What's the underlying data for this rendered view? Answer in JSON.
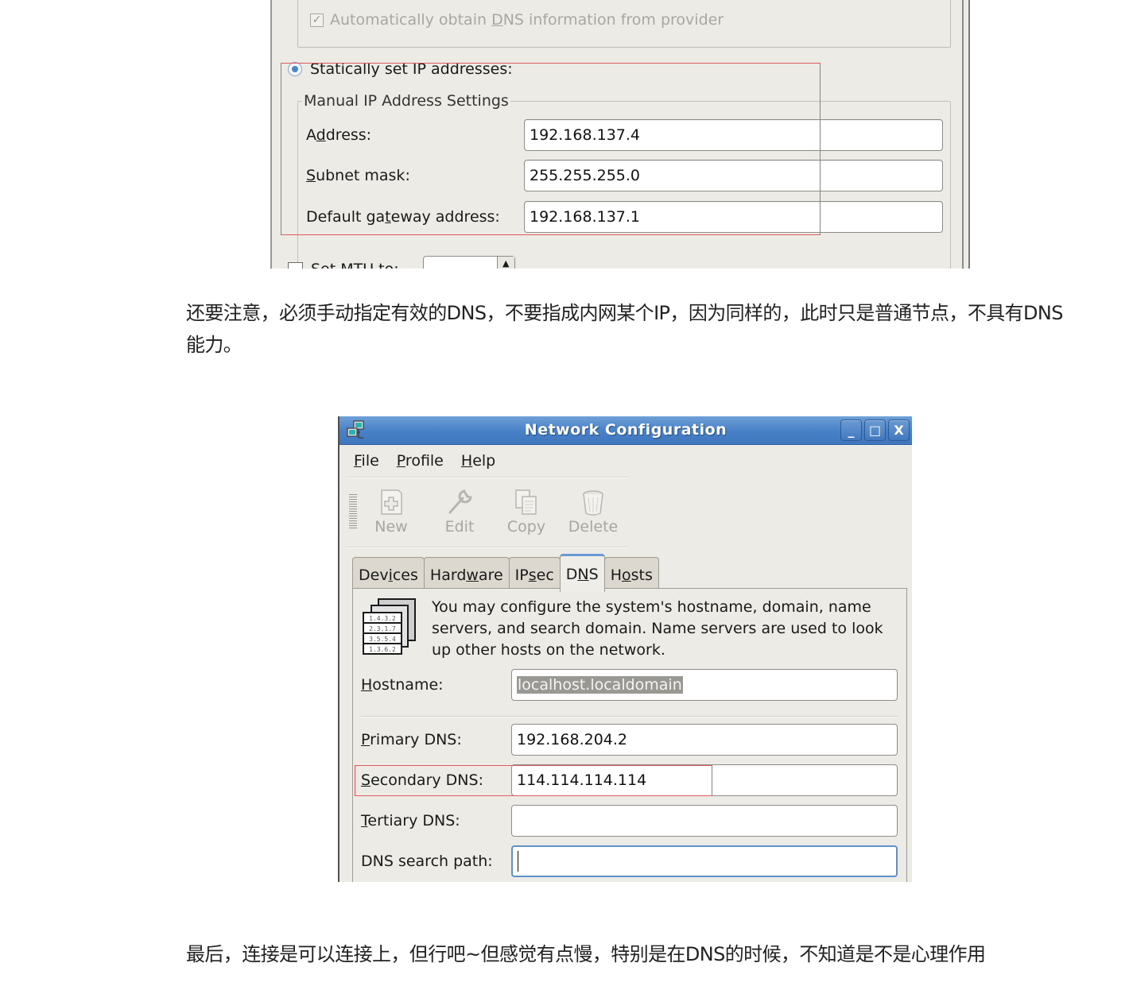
{
  "screenshot_top": {
    "auto_dns_checkbox": {
      "label_pre": "Automatically obtain ",
      "label_u": "D",
      "label_post": "NS information from provider",
      "checked": true,
      "disabled": true
    },
    "static_radio": {
      "label": "Statically set IP addresses:",
      "selected": true
    },
    "manual_group_label": "Manual IP Address Settings",
    "fields": [
      {
        "label_pre": "A",
        "label_u": "d",
        "label_post": "dress:",
        "value": "192.168.137.4"
      },
      {
        "label_pre": "",
        "label_u": "S",
        "label_post": "ubnet mask:",
        "value": "255.255.255.0"
      },
      {
        "label_pre": "Default ga",
        "label_u": "t",
        "label_post": "eway address:",
        "value": "192.168.137.1"
      }
    ],
    "mtu_label": "Set MTU to:",
    "highlight_color": "#e05a5f"
  },
  "paragraph1": "还要注意，必须手动指定有效的DNS，不要指成内网某个IP，因为同样的，此时只是普通节点，不具有DNS能力。",
  "window": {
    "title": "Network Configuration",
    "controls": {
      "minimize": "_",
      "maximize": "□",
      "close": "X"
    },
    "menu": [
      {
        "u": "F",
        "rest": "ile"
      },
      {
        "u": "P",
        "rest": "rofile"
      },
      {
        "u": "H",
        "rest": "elp"
      }
    ],
    "toolbar": [
      {
        "label": "New",
        "icon": "new-icon",
        "disabled": true
      },
      {
        "label": "Edit",
        "icon": "wrench-icon",
        "disabled": true
      },
      {
        "label": "Copy",
        "icon": "copy-icon",
        "disabled": true
      },
      {
        "label": "Delete",
        "icon": "trash-icon",
        "disabled": true
      }
    ],
    "tabs": [
      {
        "pre": "Dev",
        "u": "i",
        "post": "ces",
        "active": false
      },
      {
        "pre": "Hard",
        "u": "w",
        "post": "are",
        "active": false
      },
      {
        "pre": "IP",
        "u": "s",
        "post": "ec",
        "active": false
      },
      {
        "pre": "D",
        "u": "N",
        "post": "S",
        "active": true
      },
      {
        "pre": "H",
        "u": "o",
        "post": "sts",
        "active": false
      }
    ],
    "dns_panel": {
      "description": "You may configure the system's hostname, domain, name servers, and search domain. Name servers are used to look up other hosts on the network.",
      "icon_rows": [
        "1.4.3.2",
        "2.3.1.7",
        "3.5.5.4",
        "1.3.6.2"
      ],
      "hostname": {
        "label_u": "H",
        "label_rest": "ostname:",
        "value": "localhost.localdomain",
        "selected": true
      },
      "primary_dns": {
        "label_u": "P",
        "label_rest": "rimary DNS:",
        "value": "192.168.204.2"
      },
      "secondary_dns": {
        "label_u": "S",
        "label_rest": "econdary DNS:",
        "value": "114.114.114.114"
      },
      "tertiary_dns": {
        "label_u": "T",
        "label_rest": "ertiary DNS:",
        "value": ""
      },
      "search_path": {
        "label": "DNS search path:",
        "value": "",
        "focused": true
      }
    },
    "titlebar_color": "#4a82c8",
    "highlight_color": "#e05a5f"
  },
  "paragraph2": "最后，连接是可以连接上，但行吧~但感觉有点慢，特别是在DNS的时候，不知道是不是心理作用"
}
